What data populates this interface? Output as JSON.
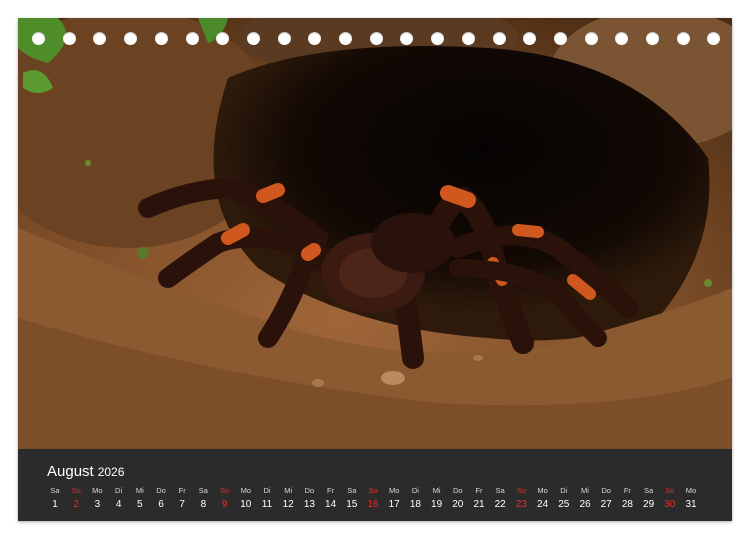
{
  "calendar": {
    "month": "August",
    "year": "2026",
    "days": [
      {
        "name": "Sa",
        "num": "1"
      },
      {
        "name": "So",
        "num": "2",
        "sunday": true
      },
      {
        "name": "Mo",
        "num": "3"
      },
      {
        "name": "Di",
        "num": "4"
      },
      {
        "name": "Mi",
        "num": "5"
      },
      {
        "name": "Do",
        "num": "6"
      },
      {
        "name": "Fr",
        "num": "7"
      },
      {
        "name": "Sa",
        "num": "8"
      },
      {
        "name": "So",
        "num": "9",
        "sunday": true
      },
      {
        "name": "Mo",
        "num": "10"
      },
      {
        "name": "Di",
        "num": "11"
      },
      {
        "name": "Mi",
        "num": "12"
      },
      {
        "name": "Do",
        "num": "13"
      },
      {
        "name": "Fr",
        "num": "14"
      },
      {
        "name": "Sa",
        "num": "15"
      },
      {
        "name": "So",
        "num": "16",
        "sunday": true
      },
      {
        "name": "Mo",
        "num": "17"
      },
      {
        "name": "Di",
        "num": "18"
      },
      {
        "name": "Mi",
        "num": "19"
      },
      {
        "name": "Do",
        "num": "20"
      },
      {
        "name": "Fr",
        "num": "21"
      },
      {
        "name": "Sa",
        "num": "22"
      },
      {
        "name": "So",
        "num": "23",
        "sunday": true
      },
      {
        "name": "Mo",
        "num": "24"
      },
      {
        "name": "Di",
        "num": "25"
      },
      {
        "name": "Mi",
        "num": "26"
      },
      {
        "name": "Do",
        "num": "27"
      },
      {
        "name": "Fr",
        "num": "28"
      },
      {
        "name": "Sa",
        "num": "29"
      },
      {
        "name": "So",
        "num": "30",
        "sunday": true
      },
      {
        "name": "Mo",
        "num": "31"
      }
    ]
  },
  "binding": {
    "ring_count": 23
  },
  "colors": {
    "sunday": "#e03030",
    "weekday": "#ffffff",
    "band": "#2b2b2b"
  }
}
